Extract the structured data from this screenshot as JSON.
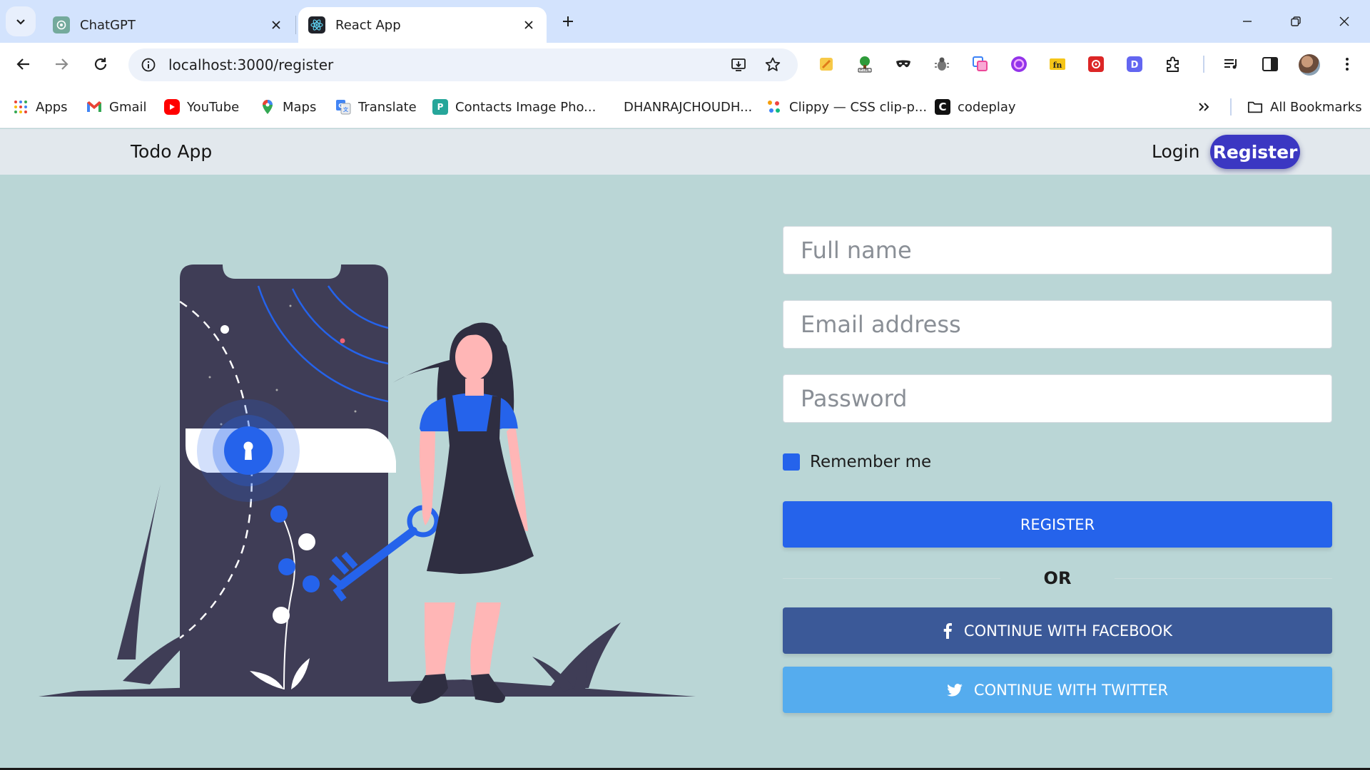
{
  "browser": {
    "tabs": [
      {
        "title": "ChatGPT",
        "icon": "chatgpt-icon",
        "active": false
      },
      {
        "title": "React App",
        "icon": "react-icon",
        "active": true
      }
    ],
    "url": "localhost:3000/register",
    "bookmarks": [
      {
        "label": "Apps",
        "icon": "apps-grid-icon"
      },
      {
        "label": "Gmail",
        "icon": "gmail-icon"
      },
      {
        "label": "YouTube",
        "icon": "youtube-icon"
      },
      {
        "label": "Maps",
        "icon": "maps-icon"
      },
      {
        "label": "Translate",
        "icon": "translate-icon"
      },
      {
        "label": "Contacts Image Pho...",
        "icon": "contacts-icon"
      },
      {
        "label": "DHANRAJCHOUDH...",
        "icon": ""
      },
      {
        "label": "Clippy — CSS clip-p...",
        "icon": "clippy-icon"
      },
      {
        "label": "codeplay",
        "icon": "codeplay-icon"
      }
    ],
    "all_bookmarks": "All Bookmarks"
  },
  "app": {
    "brand": "Todo App",
    "nav": {
      "login": "Login",
      "register": "Register"
    },
    "form": {
      "fullname_placeholder": "Full name",
      "email_placeholder": "Email address",
      "password_placeholder": "Password",
      "remember_label": "Remember me",
      "remember_checked": true,
      "register_button": "REGISTER",
      "or_text": "OR",
      "facebook_button": "CONTINUE WITH FACEBOOK",
      "twitter_button": "CONTINUE WITH TWITTER"
    }
  },
  "colors": {
    "page_bg": "#bad6d6",
    "navbar_bg": "#e2e8ed",
    "accent": "#3b37c2",
    "primary": "#2563eb",
    "facebook": "#3b5998",
    "twitter": "#55acee",
    "illustration_dark": "#3f3d56"
  }
}
